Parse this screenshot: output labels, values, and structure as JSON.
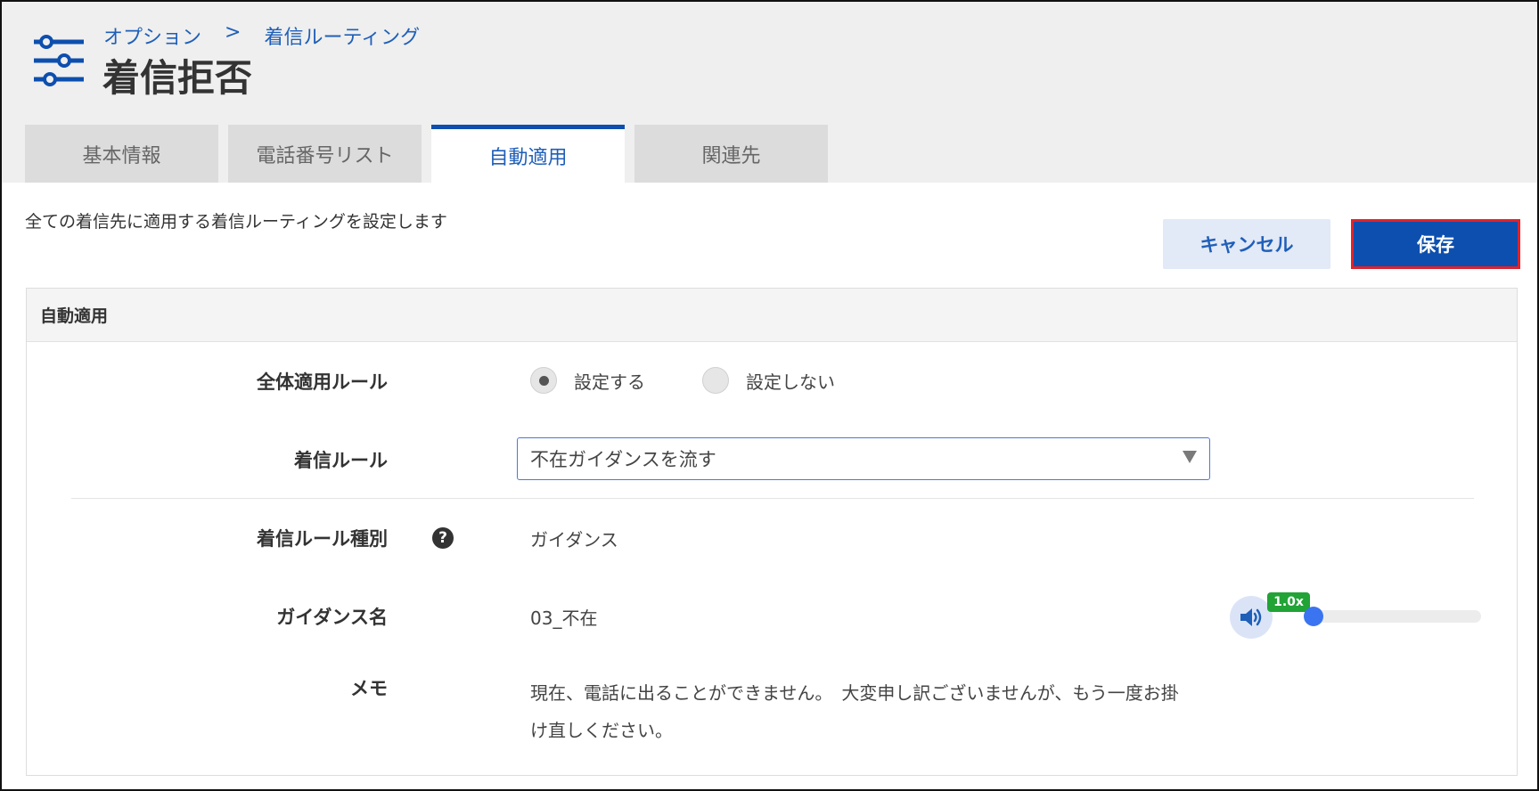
{
  "breadcrumb": {
    "parent": "オプション",
    "separator": ">",
    "current": "着信ルーティング"
  },
  "page_title": "着信拒否",
  "tabs": [
    {
      "label": "基本情報",
      "active": false
    },
    {
      "label": "電話番号リスト",
      "active": false
    },
    {
      "label": "自動適用",
      "active": true
    },
    {
      "label": "関連先",
      "active": false
    }
  ],
  "description": "全ての着信先に適用する着信ルーティングを設定します",
  "buttons": {
    "cancel": "キャンセル",
    "save": "保存"
  },
  "panel": {
    "title": "自動適用",
    "global_rule": {
      "label": "全体適用ルール",
      "options": [
        {
          "label": "設定する",
          "selected": true
        },
        {
          "label": "設定しない",
          "selected": false
        }
      ]
    },
    "incoming_rule": {
      "label": "着信ルール",
      "selected": "不在ガイダンスを流す"
    },
    "rule_type": {
      "label": "着信ルール種別",
      "help_icon": "question-circle-icon",
      "value": "ガイダンス"
    },
    "guidance_name": {
      "label": "ガイダンス名",
      "value": "03_不在",
      "player": {
        "speed": "1.0x",
        "progress": 0.0
      }
    },
    "memo": {
      "label": "メモ",
      "value": "現在、電話に出ることができません。　大変申し訳ございませんが、もう一度お掛け直しください。"
    }
  },
  "colors": {
    "brand_blue": "#0d4fae",
    "link_blue": "#1f5fb8",
    "highlight_red": "#e0222b",
    "speed_green": "#21a336"
  }
}
